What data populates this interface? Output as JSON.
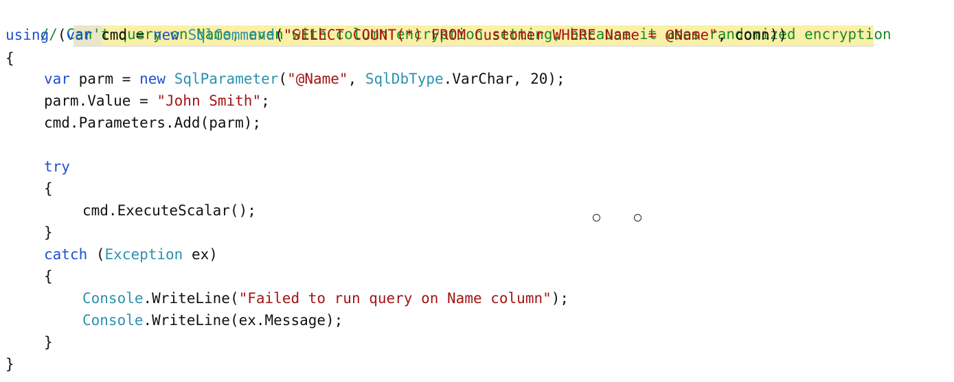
{
  "code": {
    "line1_comment": "// Can't query on Name, even with column encryption setting, because it uses randomized encryption",
    "line2": {
      "kw_using": "using",
      "open_paren": " (",
      "kw_var": "var",
      "text1": " cmd = ",
      "kw_new": "new",
      "sp": " ",
      "type_sqlcommand": "SqlCommand",
      "open2": "(",
      "str_sql": "\"SELECT COUNT(*) FROM Customer WHERE Name = @Name\"",
      "rest": ", conn))"
    },
    "line3": "{",
    "line4": {
      "kw_var": "var",
      "text1": " parm = ",
      "kw_new": "new",
      "sp": " ",
      "type_sqlparameter": "SqlParameter",
      "open": "(",
      "str_name": "\"@Name\"",
      "comma": ", ",
      "type_sqldbtype": "SqlDbType",
      "text2": ".VarChar, 20);"
    },
    "line5": {
      "text1": "parm.Value = ",
      "str_value": "\"John Smith\"",
      "text2": ";"
    },
    "line6": "cmd.Parameters.Add(parm);",
    "line8": "try",
    "line9": "{",
    "line10": "cmd.ExecuteScalar();",
    "line11": "}",
    "line12": {
      "kw_catch": "catch",
      "open": " (",
      "type_exception": "Exception",
      "text1": " ex)"
    },
    "line13": "{",
    "line14": {
      "type_console": "Console",
      "text1": ".WriteLine(",
      "str_msg": "\"Failed to run query on Name column\"",
      "text2": ");"
    },
    "line15": {
      "type_console": "Console",
      "text1": ".WriteLine(ex.Message);"
    },
    "line16": "}",
    "line17": "}"
  }
}
